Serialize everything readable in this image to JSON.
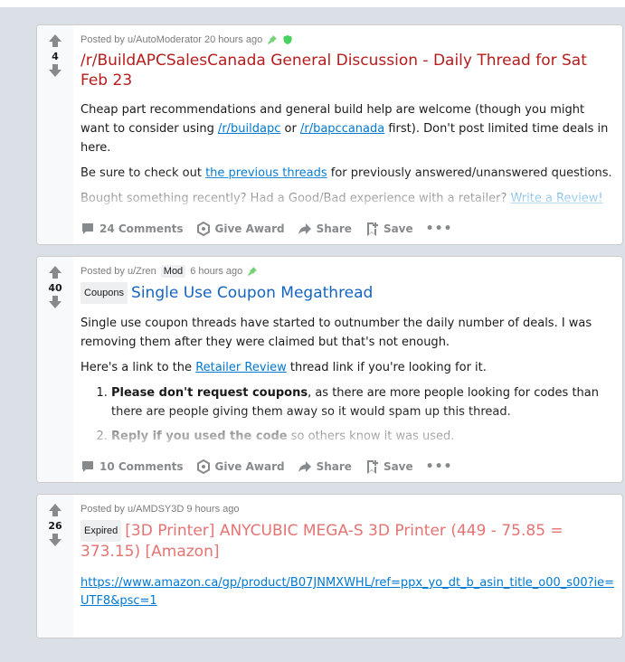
{
  "posts": [
    {
      "score": "4",
      "meta": "Posted by u/AutoModerator 20 hours ago",
      "title": "/r/BuildAPCSalesCanada General Discussion - Daily Thread for Sat Feb 23",
      "body": {
        "p1_before": "Cheap part recommendations and general build help are welcome (though you might want to consider using ",
        "p1_link1": "/r/buildapc",
        "p1_mid": " or ",
        "p1_link2": "/r/bapccanada",
        "p1_after": " first). Don't post limited time deals in here.",
        "p2_before": "Be sure to check out ",
        "p2_link": "the previous threads",
        "p2_after": " for previously answered/unanswered questions.",
        "p3_before": "Bought something recently? Had a Good/Bad experience with a retailer? ",
        "p3_link": "Write a Review!"
      },
      "actions": {
        "comments": "24 Comments",
        "award": "Give Award",
        "share": "Share",
        "save": "Save",
        "more": "•••"
      }
    },
    {
      "score": "40",
      "meta_prefix": "Posted by u/Zren",
      "mod_tag": "Mod",
      "meta_time": "6 hours ago",
      "flair": "Coupons",
      "title": "Single Use Coupon Megathread",
      "body": {
        "p1": "Single use coupon threads have started to outnumber the daily number of deals. I was removing them after they were claimed but that's not enough.",
        "p2_before": "Here's a link to the ",
        "p2_link": "Retailer Review",
        "p2_after": " thread link if you're looking for it.",
        "li1_bold": "Please don't request coupons",
        "li1_rest": ", as there are more people looking for codes than there are people giving them away so it would spam up this thread.",
        "li2_bold": "Reply if you used the code",
        "li2_rest": " so others know it was used."
      },
      "actions": {
        "comments": "10 Comments",
        "award": "Give Award",
        "share": "Share",
        "save": "Save",
        "more": "•••"
      }
    },
    {
      "score": "26",
      "meta": "Posted by u/AMDSY3D 9 hours ago",
      "flair": "Expired",
      "title": "[3D Printer] ANYCUBIC MEGA-S 3D Printer (449 - 75.85 = 373.15) [Amazon]",
      "link": "https://www.amazon.ca/gp/product/B07JNMXWHL/ref=ppx_yo_dt_b_asin_title_o00_s00?ie=UTF8&psc=1"
    }
  ],
  "colors": {
    "page_bg": "#dae0e6",
    "pin": "#75d377",
    "shield": "#46d160",
    "link": "#0079d3",
    "title_red": "#b71c1c",
    "title_blue": "#1565c0",
    "title_salmon": "#e57373"
  },
  "icons": [
    "upvote-icon",
    "downvote-icon",
    "pin-icon",
    "shield-icon",
    "comment-icon",
    "award-icon",
    "share-icon",
    "save-icon"
  ]
}
